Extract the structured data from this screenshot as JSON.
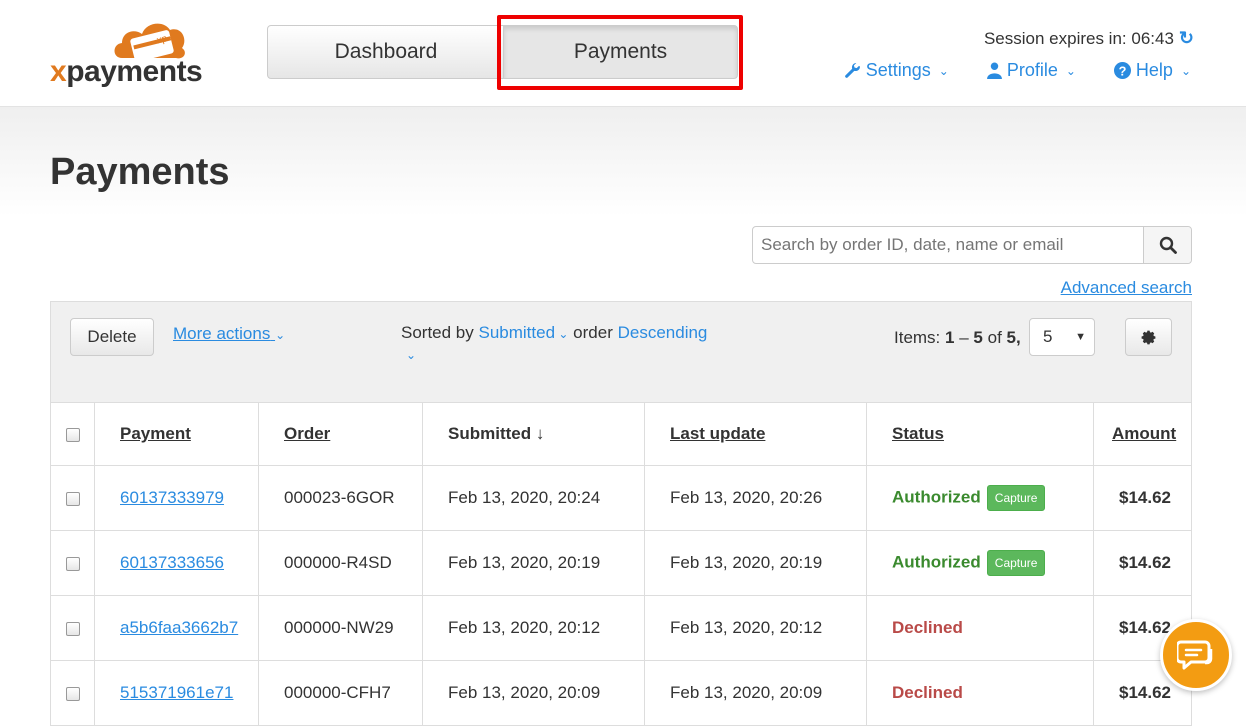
{
  "brand": {
    "logo_text": "xpayments",
    "logo_prefix": "x",
    "logo_rest": "payments",
    "badge": "xp",
    "accent": "#e07a1f"
  },
  "nav": {
    "dashboard": "Dashboard",
    "payments": "Payments"
  },
  "header": {
    "session_label": "Session expires in: 06:43",
    "menus": {
      "settings": "Settings",
      "profile": "Profile",
      "help": "Help"
    },
    "icons": {
      "settings": "wrench-icon",
      "profile": "user-icon",
      "help": "question-circle-icon",
      "refresh": "refresh-icon"
    }
  },
  "page": {
    "title": "Payments"
  },
  "search": {
    "placeholder": "Search by order ID, date, name or email",
    "advanced": "Advanced search"
  },
  "toolbar": {
    "delete": "Delete",
    "more_actions": "More actions",
    "sorted_by_label": "Sorted by",
    "sorted_by_value": "Submitted",
    "order_label": "order",
    "order_value": "Descending",
    "items_label": "Items:",
    "items_from": "1",
    "items_to": "5",
    "items_of": "of",
    "items_total": "5,",
    "per_page": "5"
  },
  "table": {
    "columns": [
      "Payment",
      "Order",
      "Submitted ↓",
      "Last update",
      "Status",
      "Amount"
    ],
    "rows": [
      {
        "payment": "60137333979",
        "order": "000023-6GOR",
        "submitted": "Feb 13, 2020, 20:24",
        "updated": "Feb 13, 2020, 20:26",
        "status": "Authorized",
        "action": "Capture",
        "amount": "$14.62"
      },
      {
        "payment": "60137333656",
        "order": "000000-R4SD",
        "submitted": "Feb 13, 2020, 20:19",
        "updated": "Feb 13, 2020, 20:19",
        "status": "Authorized",
        "action": "Capture",
        "amount": "$14.62"
      },
      {
        "payment": "a5b6faa3662b7",
        "order": "000000-NW29",
        "submitted": "Feb 13, 2020, 20:12",
        "updated": "Feb 13, 2020, 20:12",
        "status": "Declined",
        "action": "",
        "amount": "$14.62"
      },
      {
        "payment": "515371961e71",
        "order": "000000-CFH7",
        "submitted": "Feb 13, 2020, 20:09",
        "updated": "Feb 13, 2020, 20:09",
        "status": "Declined",
        "action": "",
        "amount": "$14.62"
      }
    ]
  },
  "colors": {
    "link": "#2a8be0",
    "authorized": "#3a8a2e",
    "declined": "#b94a48",
    "capture": "#5cb85c",
    "highlight": "#e00000",
    "chat": "#f39c12"
  }
}
